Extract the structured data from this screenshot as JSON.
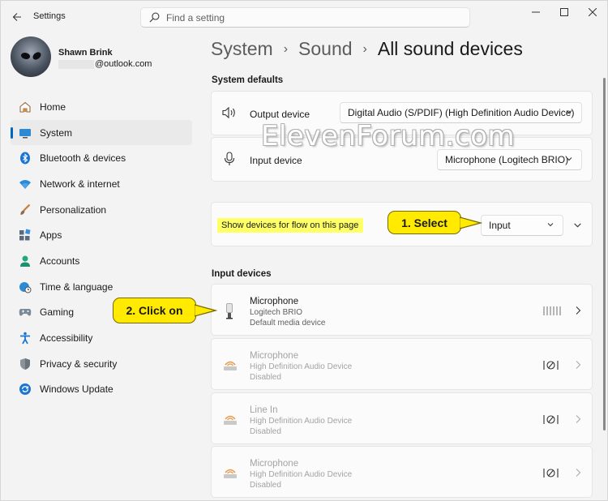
{
  "app": {
    "title": "Settings"
  },
  "search": {
    "placeholder": "Find a setting"
  },
  "profile": {
    "name": "Shawn Brink",
    "email": "@outlook.com"
  },
  "sidebar": {
    "items": [
      {
        "label": "Home",
        "icon": "home-icon",
        "active": false
      },
      {
        "label": "System",
        "icon": "system-icon",
        "active": true
      },
      {
        "label": "Bluetooth & devices",
        "icon": "bluetooth-icon",
        "active": false
      },
      {
        "label": "Network & internet",
        "icon": "wifi-icon",
        "active": false
      },
      {
        "label": "Personalization",
        "icon": "brush-icon",
        "active": false
      },
      {
        "label": "Apps",
        "icon": "apps-icon",
        "active": false
      },
      {
        "label": "Accounts",
        "icon": "accounts-icon",
        "active": false
      },
      {
        "label": "Time & language",
        "icon": "globe-clock-icon",
        "active": false
      },
      {
        "label": "Gaming",
        "icon": "gamepad-icon",
        "active": false
      },
      {
        "label": "Accessibility",
        "icon": "accessibility-icon",
        "active": false
      },
      {
        "label": "Privacy & security",
        "icon": "shield-icon",
        "active": false
      },
      {
        "label": "Windows Update",
        "icon": "update-icon",
        "active": false
      }
    ]
  },
  "breadcrumb": {
    "parent1": "System",
    "parent2": "Sound",
    "current": "All sound devices"
  },
  "system_defaults": {
    "heading": "System defaults",
    "output_label": "Output device",
    "output_value": "Digital Audio (S/PDIF) (High Definition Audio Device)",
    "input_label": "Input device",
    "input_value": "Microphone (Logitech BRIO)"
  },
  "flow": {
    "label": "Show devices for flow on this page",
    "value": "Input"
  },
  "input_devices": {
    "heading": "Input devices",
    "devices": [
      {
        "name": "Microphone",
        "line2": "Logitech BRIO",
        "line3": "Default media device",
        "disabled": false
      },
      {
        "name": "Microphone",
        "line2": "High Definition Audio Device",
        "line3": "Disabled",
        "disabled": true
      },
      {
        "name": "Line In",
        "line2": "High Definition Audio Device",
        "line3": "Disabled",
        "disabled": true
      },
      {
        "name": "Microphone",
        "line2": "High Definition Audio Device",
        "line3": "Disabled",
        "disabled": true
      }
    ]
  },
  "callouts": {
    "select": "1. Select",
    "click": "2. Click on"
  },
  "watermark": "ElevenForum.com",
  "colors": {
    "accent": "#0067c0",
    "callout": "#ffea00",
    "highlight": "#ffff66"
  }
}
